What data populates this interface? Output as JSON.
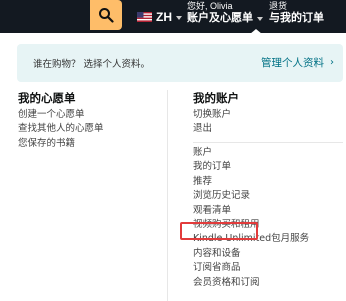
{
  "nav": {
    "search_icon": "search-icon",
    "lang_label": "ZH",
    "flag_icon": "us-flag-icon",
    "greeting": "您好, Olivia",
    "account_label": "账户及心愿单",
    "returns_small": "退货",
    "returns_big": "与我的订单"
  },
  "banner": {
    "text": "谁在购物？ 选择个人资料。",
    "link": "管理个人资料",
    "chevron": "›"
  },
  "wishlist": {
    "title": "我的心愿单",
    "items": [
      {
        "label": "创建一个心愿单"
      },
      {
        "label": "查找其他人的心愿单"
      },
      {
        "label": "您保存的书籍"
      }
    ]
  },
  "account": {
    "title": "我的账户",
    "top_items": [
      {
        "label": "切换账户"
      },
      {
        "label": "退出"
      }
    ],
    "items": [
      {
        "label": "账户"
      },
      {
        "label": "我的订单"
      },
      {
        "label": "推荐"
      },
      {
        "label": "浏览历史记录"
      },
      {
        "label": "观看清单"
      },
      {
        "label": "视频购买和租用"
      },
      {
        "label": "Kindle Unlimited包月服务"
      },
      {
        "label": "内容和设备"
      },
      {
        "label": "订阅省商品"
      },
      {
        "label": "会员资格和订阅"
      }
    ]
  },
  "colors": {
    "nav_bg": "#131921",
    "search_accent": "#febd69",
    "link": "#007185",
    "banner_bg": "#e7f4f5",
    "highlight": "#e23b3b"
  }
}
